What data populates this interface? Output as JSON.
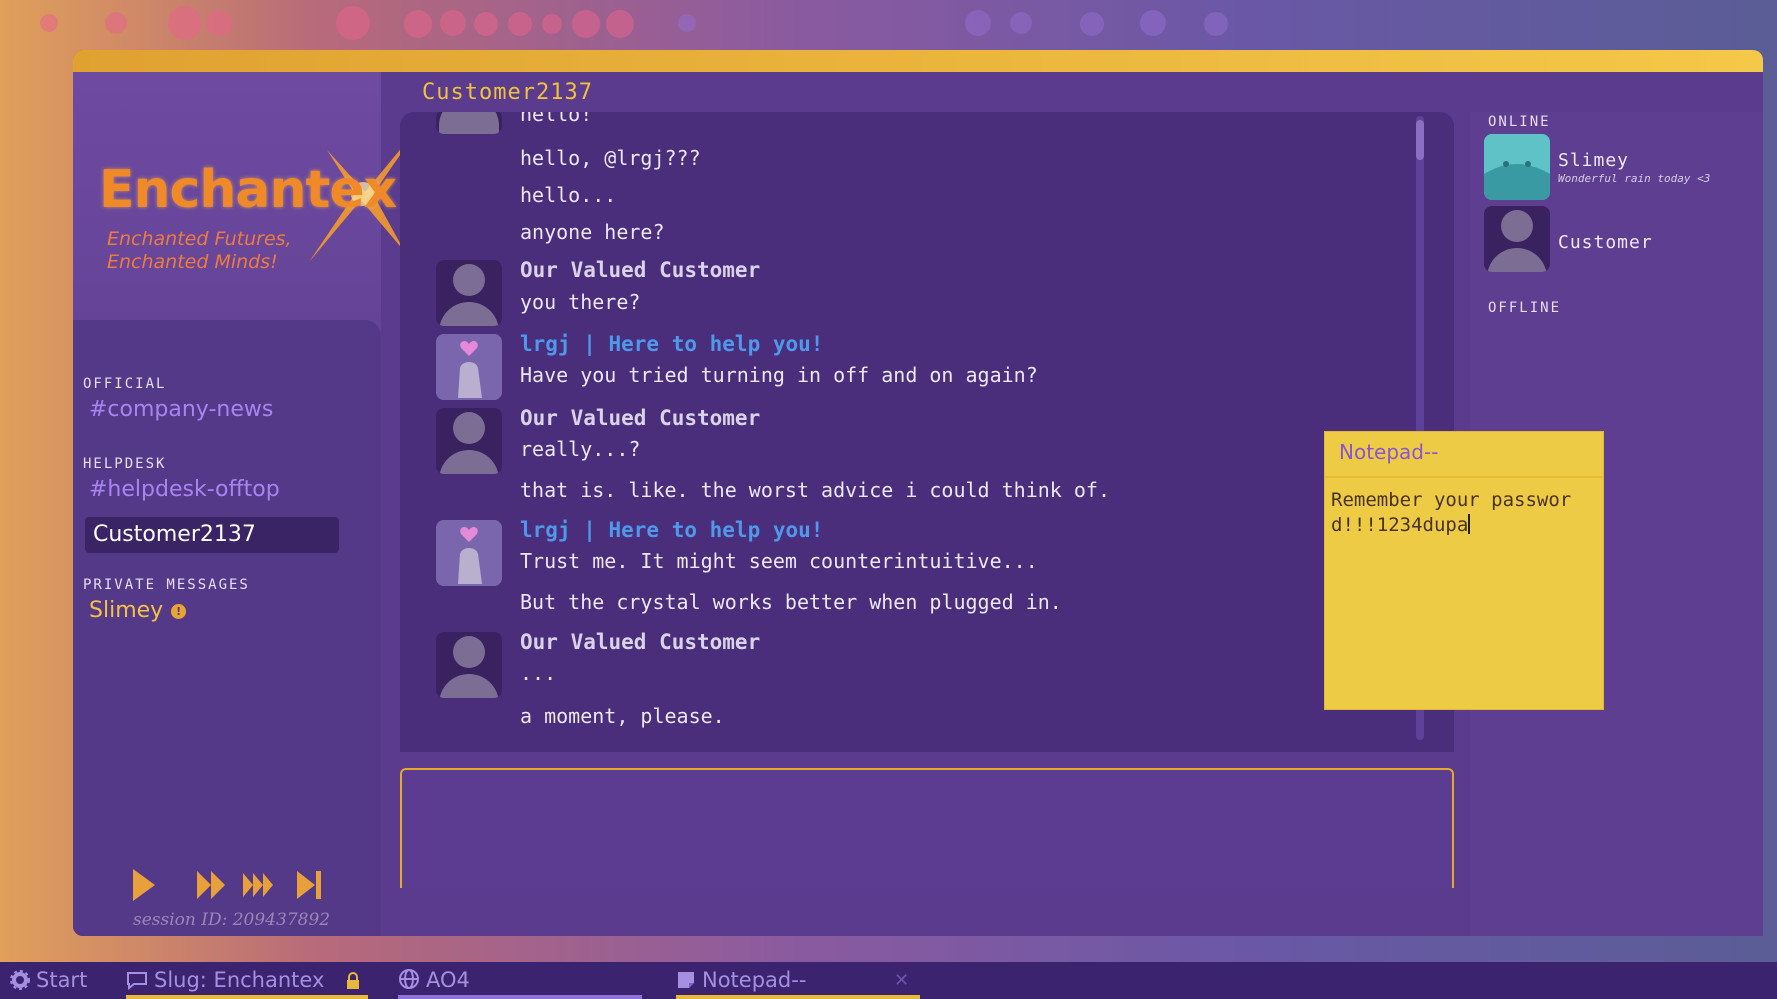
{
  "colors": {
    "accent": "#f0c23c",
    "agent_name": "#4f98ea",
    "channel_link": "#a884f0",
    "notepad_bg": "#eecb44"
  },
  "logo": {
    "word": "Enchantex",
    "tagline_1": "Enchanted Futures,",
    "tagline_2": "Enchanted Minds!"
  },
  "sidebar": {
    "official_label": "OFFICIAL",
    "official_channel": "#company-news",
    "helpdesk_label": "HELPDESK",
    "helpdesk_channel": "#helpdesk-offtop",
    "active_channel": "Customer2137",
    "private_label": "PRIVATE MESSAGES",
    "private_user": "Slimey",
    "private_badge": "!",
    "session": "session ID: 209437892"
  },
  "chat": {
    "title": "Customer2137",
    "messages": [
      {
        "text": "hello!"
      },
      {
        "text": "hello, @lrgj???"
      },
      {
        "text": "hello..."
      },
      {
        "text": "anyone here?"
      },
      {
        "author": "Our Valued Customer",
        "text": "you there?"
      },
      {
        "author": "lrgj | Here to help you!",
        "text": "Have you tried turning in off and on again?"
      },
      {
        "author": "Our Valued Customer",
        "text": "really...?"
      },
      {
        "text": "that is. like. the worst advice i could think of."
      },
      {
        "author": "lrgj | Here to help you!",
        "text": "Trust me. It might seem counterintuitive..."
      },
      {
        "text": "But the crystal works better when plugged in."
      },
      {
        "author": "Our Valued Customer",
        "text": "..."
      },
      {
        "text": "a moment, please."
      }
    ],
    "composer_value": ""
  },
  "users": {
    "online_label": "ONLINE",
    "offline_label": "OFFLINE",
    "online": [
      {
        "name": "Slimey",
        "status": "Wonderful rain today <3"
      },
      {
        "name": "Customer",
        "status": ""
      }
    ]
  },
  "notepad": {
    "title": "Notepad--",
    "content": "Remember your password!!!1234dupa"
  },
  "taskbar": {
    "start": "Start",
    "slug": "Slug: Enchantex",
    "ao4": "AO4",
    "notepad": "Notepad--",
    "close": "✕"
  }
}
